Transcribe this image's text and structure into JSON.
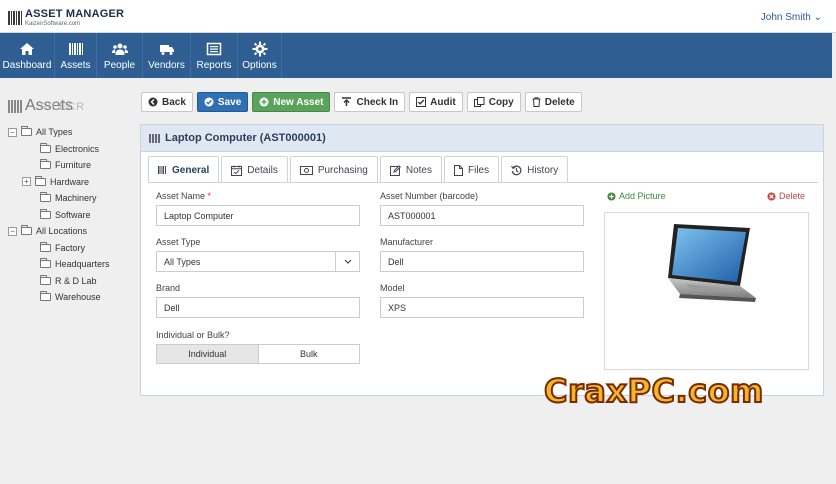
{
  "app": {
    "logo_title": "ASSET MANAGER",
    "logo_sub": "KaizenSoftware.com",
    "user": "John Smith"
  },
  "nav": [
    {
      "label": "Dashboard",
      "icon": "home-icon"
    },
    {
      "label": "Assets",
      "icon": "barcode-icon"
    },
    {
      "label": "People",
      "icon": "people-icon"
    },
    {
      "label": "Vendors",
      "icon": "truck-icon"
    },
    {
      "label": "Reports",
      "icon": "list-icon"
    },
    {
      "label": "Options",
      "icon": "gear-icon"
    }
  ],
  "sidebar": {
    "title": "Assets",
    "watermark": "FILECR",
    "tree": [
      {
        "label": "All Types",
        "level": 0,
        "toggle": "−"
      },
      {
        "label": "Electronics",
        "level": 1
      },
      {
        "label": "Furniture",
        "level": 1
      },
      {
        "label": "Hardware",
        "level": 1,
        "toggle": "+"
      },
      {
        "label": "Machinery",
        "level": 1
      },
      {
        "label": "Software",
        "level": 1
      },
      {
        "label": "All Locations",
        "level": 0,
        "toggle": "−"
      },
      {
        "label": "Factory",
        "level": 1
      },
      {
        "label": "Headquarters",
        "level": 1
      },
      {
        "label": "R & D Lab",
        "level": 1
      },
      {
        "label": "Warehouse",
        "level": 1
      }
    ]
  },
  "toolbar": {
    "back": "Back",
    "save": "Save",
    "new_asset": "New Asset",
    "check_in": "Check In",
    "audit": "Audit",
    "copy": "Copy",
    "delete": "Delete"
  },
  "panel": {
    "title": "Laptop Computer (AST000001)",
    "tabs": [
      "General",
      "Details",
      "Purchasing",
      "Notes",
      "Files",
      "History"
    ],
    "form": {
      "asset_name_label": "Asset Name",
      "asset_name_req": "*",
      "asset_name": "Laptop Computer",
      "asset_number_label": "Asset Number (barcode)",
      "asset_number": "AST000001",
      "asset_type_label": "Asset Type",
      "asset_type": "All Types",
      "manufacturer_label": "Manufacturer",
      "manufacturer": "Dell",
      "brand_label": "Brand",
      "brand": "Dell",
      "model_label": "Model",
      "model": "XPS",
      "bulk_label": "Individual or Bulk?",
      "individual": "Individual",
      "bulk": "Bulk"
    },
    "picture": {
      "add": "Add Picture",
      "delete": "Delete"
    }
  },
  "watermark": "CraxPC.com",
  "colors": {
    "nav_bg": "#2f5e93",
    "save": "#2f6fb4",
    "new_asset": "#5aa35a"
  }
}
